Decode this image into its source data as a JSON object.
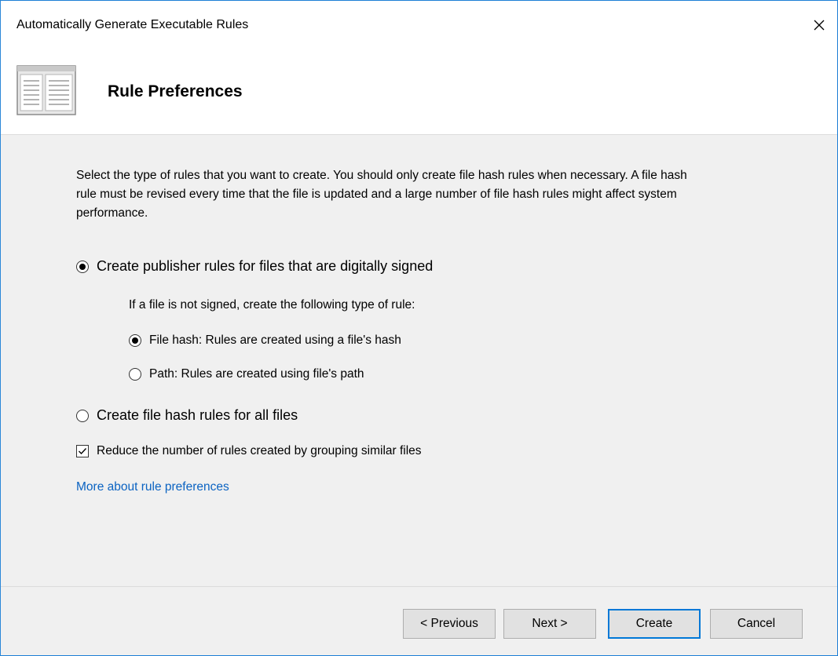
{
  "window": {
    "title": "Automatically Generate Executable Rules",
    "close_label": "×",
    "accent_color": "#0078d7"
  },
  "header": {
    "icon": "window-layout-icon",
    "title": "Rule Preferences"
  },
  "content": {
    "description": "Select the type of rules that you want to create. You should only create file hash rules when necessary. A file hash rule must be revised every time that the file is updated and a large number of file hash rules might affect system performance.",
    "options": {
      "publisher": {
        "label": "Create publisher rules for files that are digitally signed",
        "checked": true
      },
      "unsigned_note": "If a file is not signed, create the following type of rule:",
      "file_hash": {
        "label": "File hash: Rules are created using a file's hash",
        "checked": true
      },
      "path": {
        "label": "Path: Rules are created using file's path",
        "checked": false
      },
      "all_hash": {
        "label": "Create file hash rules for all files",
        "checked": false
      },
      "reduce": {
        "label": "Reduce the number of rules created by grouping similar files",
        "checked": true
      }
    },
    "link": "More about rule preferences",
    "link_color": "#0b63c2"
  },
  "footer": {
    "previous_label": "< Previous",
    "next_label": "Next >",
    "create_label": "Create",
    "cancel_label": "Cancel"
  }
}
